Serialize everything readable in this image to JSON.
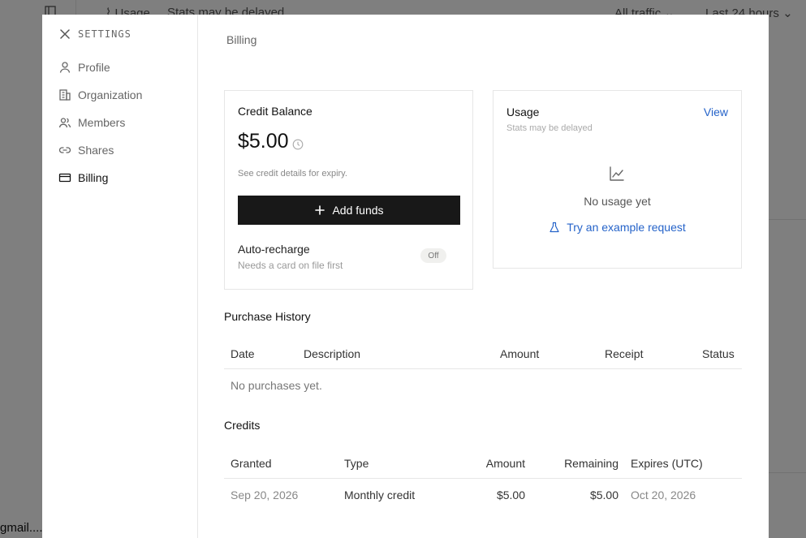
{
  "background": {
    "topbar_usage": "Usage",
    "topbar_delay": "Stats may be delayed",
    "topbar_traffic": "All traffic",
    "topbar_range": "Last 24 hours",
    "footer_email": "gmail...."
  },
  "settings": {
    "title": "SETTINGS",
    "nav": [
      {
        "label": "Profile",
        "icon": "user-icon"
      },
      {
        "label": "Organization",
        "icon": "building-icon"
      },
      {
        "label": "Members",
        "icon": "users-icon"
      },
      {
        "label": "Shares",
        "icon": "link-icon"
      },
      {
        "label": "Billing",
        "icon": "credit-card-icon",
        "active": true
      }
    ]
  },
  "billing": {
    "title": "Billing",
    "credit_balance": {
      "title": "Credit Balance",
      "amount": "$5.00",
      "note": "See credit details for expiry.",
      "add_funds_label": "Add funds",
      "auto_recharge_label": "Auto-recharge",
      "auto_recharge_sub": "Needs a card on file first",
      "auto_recharge_state": "Off"
    },
    "usage": {
      "title": "Usage",
      "subtitle": "Stats may be delayed",
      "view_label": "View",
      "empty": "No usage yet",
      "try_label": "Try an example request"
    },
    "purchase_history": {
      "title": "Purchase History",
      "columns": [
        "Date",
        "Description",
        "Amount",
        "Receipt",
        "Status"
      ],
      "empty": "No purchases yet."
    },
    "credits": {
      "title": "Credits",
      "columns": [
        "Granted",
        "Type",
        "Amount",
        "Remaining",
        "Expires (UTC)"
      ],
      "rows": [
        {
          "granted": "Sep 20, 2026",
          "type": "Monthly credit",
          "amount": "$5.00",
          "remaining": "$5.00",
          "expires": "Oct 20, 2026"
        }
      ]
    }
  },
  "colors": {
    "accent": "#2563c9",
    "primary_button": "#181818",
    "border": "#e6e6e6"
  }
}
